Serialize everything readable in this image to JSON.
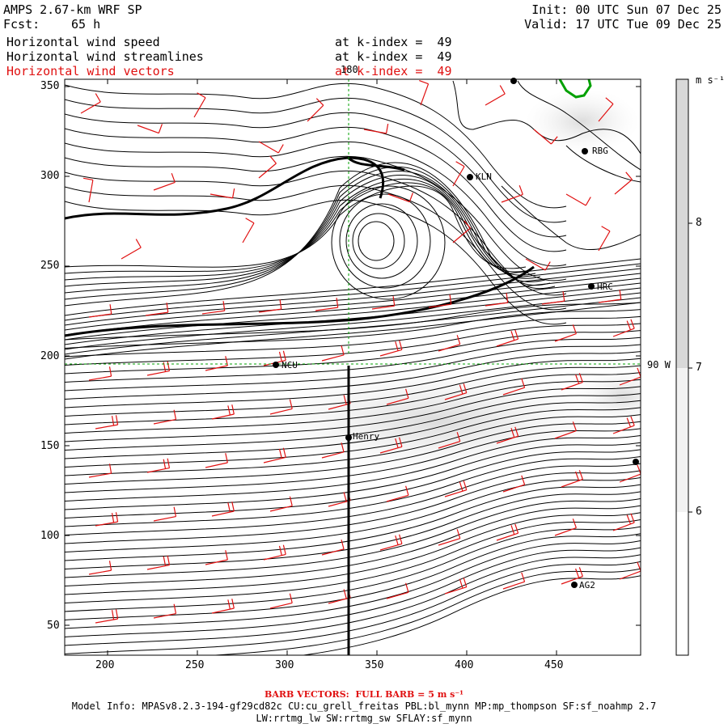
{
  "header": {
    "model": "AMPS 2.67-km WRF SP",
    "fcst_label": "Fcst:",
    "fcst_value": "65 h",
    "init": "Init: 00 UTC Sun 07 Dec 25",
    "valid": "Valid: 17 UTC Tue 09 Dec 25"
  },
  "fields": [
    {
      "name": "Horizontal wind speed",
      "level": "at k-index =  49",
      "color": "#000000"
    },
    {
      "name": "Horizontal wind streamlines",
      "level": "at k-index =  49",
      "color": "#000000"
    },
    {
      "name": "Horizontal wind vectors",
      "level": "at k-index =  49",
      "color": "#e01010"
    }
  ],
  "axes": {
    "x_ticks": [
      "200",
      "250",
      "300",
      "350",
      "400",
      "450"
    ],
    "y_ticks": [
      "350",
      "300",
      "250",
      "200",
      "150",
      "100",
      "50"
    ],
    "meridian_label": "180",
    "parallel_label": "90 W"
  },
  "colorbar": {
    "unit": "m s⁻¹",
    "ticks": [
      "8",
      "7",
      "6"
    ],
    "colors": {
      "low": "#ffffff",
      "mid": "#f2f2f2",
      "high": "#d8d8d8"
    }
  },
  "stations": [
    {
      "id": "VT",
      "label": ""
    },
    {
      "id": "RBG",
      "label": "RBG"
    },
    {
      "id": "KLN",
      "label": "KLN"
    },
    {
      "id": "HRC",
      "label": "HRC"
    },
    {
      "id": "NCU",
      "label": "NCU"
    },
    {
      "id": "Henry",
      "label": "Henry"
    },
    {
      "id": "east",
      "label": ""
    },
    {
      "id": "AG2",
      "label": "AG2"
    }
  ],
  "footer": {
    "barb": "BARB VECTORS:  FULL BARB = 5 m s⁻¹",
    "model_info": "Model Info: MPASv8.2.3-194-gf29cd82c CU:cu_grell_freitas PBL:bl_mynn MP:mp_thompson SF:sf_noahmp 2.7",
    "model_info2": "LW:rrtmg_lw SW:rrtmg_sw SFLAY:sf_mynn"
  },
  "colors": {
    "barb": "#e01010",
    "streamline": "#000000",
    "coast": "#00a000",
    "gridline": "#00a000"
  }
}
